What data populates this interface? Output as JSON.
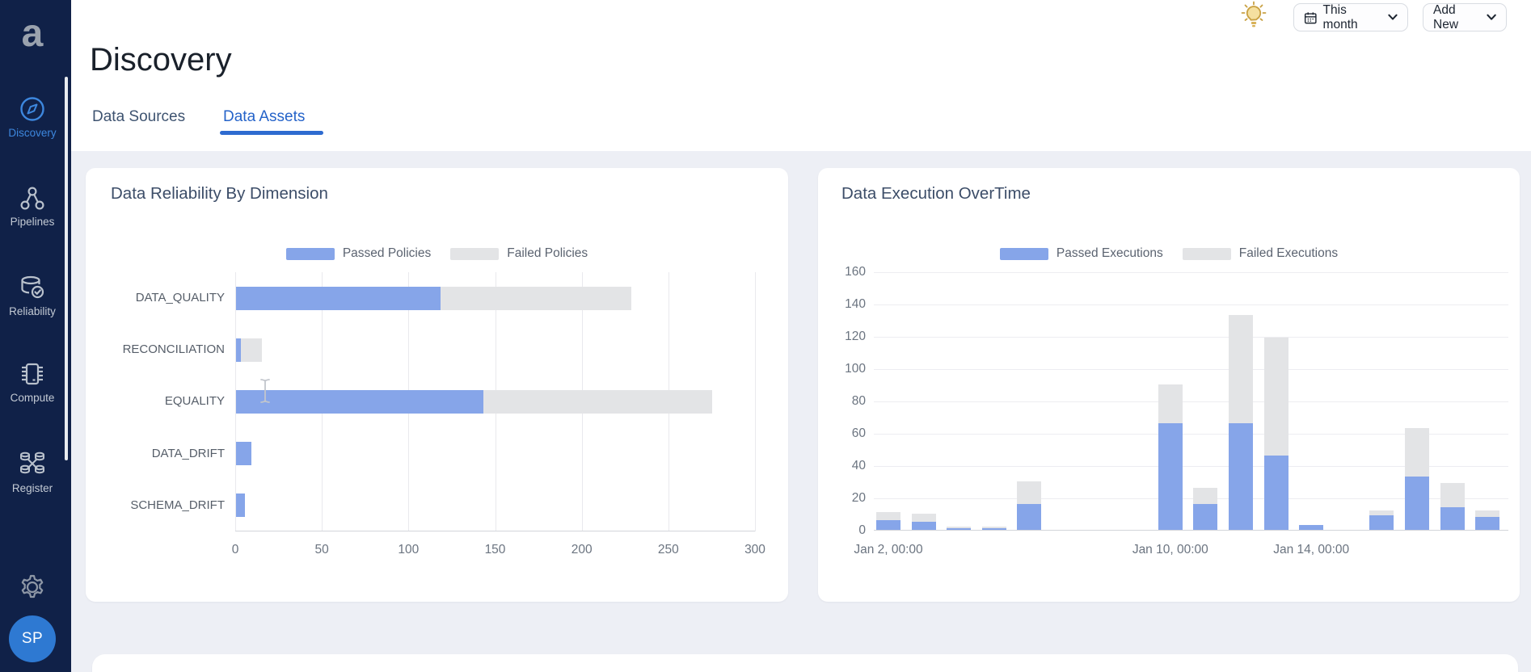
{
  "sidebar": {
    "logo": "a",
    "items": [
      {
        "label": "Discovery",
        "icon": "compass-icon",
        "active": true
      },
      {
        "label": "Pipelines",
        "icon": "pipeline-nodes-icon",
        "active": false
      },
      {
        "label": "Reliability",
        "icon": "database-check-icon",
        "active": false
      },
      {
        "label": "Compute",
        "icon": "chip-icon",
        "active": false
      },
      {
        "label": "Register",
        "icon": "register-dbs-icon",
        "active": false
      }
    ],
    "settings_icon": "gear-icon",
    "avatar_initials": "SP"
  },
  "header": {
    "title": "Discovery",
    "tabs": [
      {
        "label": "Data Sources",
        "active": false
      },
      {
        "label": "Data Assets",
        "active": true
      }
    ],
    "idea_icon": "lightbulb-icon",
    "time_range_button": {
      "label": "This month",
      "icon": "calendar-icon",
      "chevron": "chevron-down-icon"
    },
    "add_new_button": {
      "label": "Add New",
      "chevron": "chevron-down-icon"
    }
  },
  "colors": {
    "bar_blue": "#86a5e9",
    "bar_gray": "#e3e4e6",
    "sidebar_bg": "#102148",
    "accent_blue": "#3d87de",
    "tab_active_blue": "#2563c9",
    "avatar_blue": "#2e79d2",
    "content_bg": "#edeff5"
  },
  "chart_data": [
    {
      "type": "bar",
      "orientation": "horizontal",
      "stacked": true,
      "title": "Data Reliability By Dimension",
      "legend_position": "top",
      "categories": [
        "DATA_QUALITY",
        "RECONCILIATION",
        "EQUALITY",
        "DATA_DRIFT",
        "SCHEMA_DRIFT"
      ],
      "series": [
        {
          "name": "Passed Policies",
          "color": "#86a5e9",
          "values": [
            118,
            3,
            143,
            9,
            5
          ]
        },
        {
          "name": "Failed Policies",
          "color": "#e3e4e6",
          "values": [
            110,
            12,
            132,
            0,
            0
          ]
        }
      ],
      "xlim": [
        0,
        300
      ],
      "xticks": [
        0,
        50,
        100,
        150,
        200,
        250,
        300
      ],
      "grid": "vertical"
    },
    {
      "type": "bar",
      "orientation": "vertical",
      "stacked": true,
      "title": "Data Execution OverTime",
      "legend_position": "top",
      "series": [
        {
          "name": "Passed Executions",
          "color": "#86a5e9"
        },
        {
          "name": "Failed Executions",
          "color": "#e3e4e6"
        }
      ],
      "x_slot_count": 18,
      "bars": [
        {
          "slot": 0,
          "passed": 6,
          "failed": 5
        },
        {
          "slot": 1,
          "passed": 5,
          "failed": 5
        },
        {
          "slot": 2,
          "passed": 1,
          "failed": 1
        },
        {
          "slot": 3,
          "passed": 1,
          "failed": 1
        },
        {
          "slot": 4,
          "passed": 16,
          "failed": 14
        },
        {
          "slot": 8,
          "passed": 66,
          "failed": 24
        },
        {
          "slot": 9,
          "passed": 16,
          "failed": 10
        },
        {
          "slot": 10,
          "passed": 66,
          "failed": 67
        },
        {
          "slot": 11,
          "passed": 46,
          "failed": 73
        },
        {
          "slot": 12,
          "passed": 3,
          "failed": 0
        },
        {
          "slot": 14,
          "passed": 9,
          "failed": 3
        },
        {
          "slot": 15,
          "passed": 33,
          "failed": 30
        },
        {
          "slot": 16,
          "passed": 14,
          "failed": 15
        },
        {
          "slot": 17,
          "passed": 8,
          "failed": 4
        }
      ],
      "xticks": [
        {
          "slot": 0,
          "label": "Jan 2, 00:00"
        },
        {
          "slot": 8,
          "label": "Jan 10, 00:00"
        },
        {
          "slot": 12,
          "label": "Jan 14, 00:00"
        }
      ],
      "ylim": [
        0,
        160
      ],
      "yticks": [
        0,
        20,
        40,
        60,
        80,
        100,
        120,
        140,
        160
      ],
      "grid": "horizontal"
    }
  ]
}
